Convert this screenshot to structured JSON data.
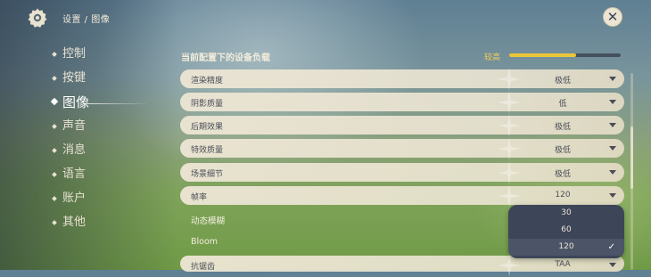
{
  "header": {
    "breadcrumb": "设置 / 图像"
  },
  "sidebar": {
    "items": [
      {
        "label": "控制"
      },
      {
        "label": "按键"
      },
      {
        "label": "图像"
      },
      {
        "label": "声音"
      },
      {
        "label": "消息"
      },
      {
        "label": "语言"
      },
      {
        "label": "账户"
      },
      {
        "label": "其他"
      }
    ],
    "active_index": 2
  },
  "main": {
    "section_title": "当前配置下的设备负载",
    "load": {
      "label": "较高",
      "level_percent": 60,
      "color": "#ecc63a"
    },
    "settings": [
      {
        "label": "渲染精度",
        "value": "极低"
      },
      {
        "label": "阴影质量",
        "value": "低"
      },
      {
        "label": "后期效果",
        "value": "极低"
      },
      {
        "label": "特效质量",
        "value": "极低"
      },
      {
        "label": "场景细节",
        "value": "极低"
      },
      {
        "label": "帧率",
        "value": "120"
      },
      {
        "label": "动态模糊",
        "value": ""
      },
      {
        "label": "Bloom",
        "value": ""
      },
      {
        "label": "抗锯齿",
        "value": "TAA"
      }
    ]
  },
  "dropdown": {
    "options": [
      "30",
      "60",
      "120"
    ],
    "selected": "120"
  },
  "colors": {
    "panel": "#ece5d3",
    "dropdown": "#3d4558",
    "text_dark": "#4a4d58"
  }
}
